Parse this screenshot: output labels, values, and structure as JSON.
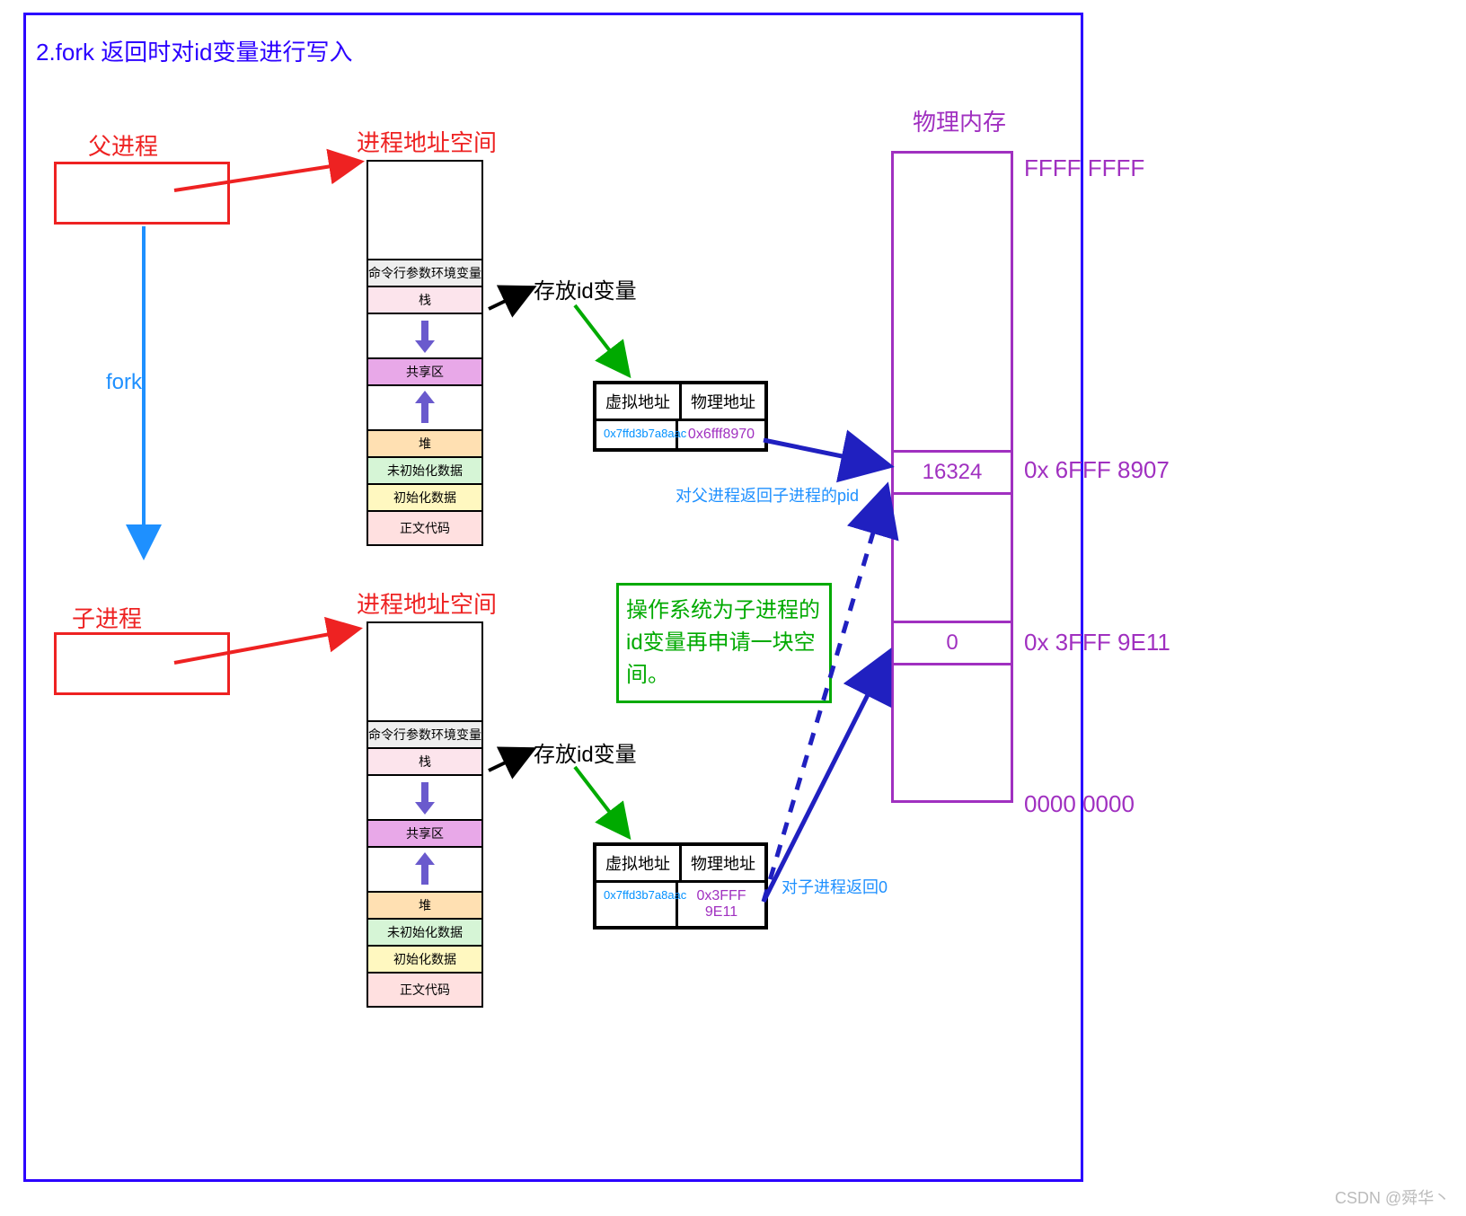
{
  "title": "2.fork 返回时对id变量进行写入",
  "process": {
    "parent_label": "父进程",
    "child_label": "子进程",
    "fork_label": "fork"
  },
  "addrspace": {
    "title": "进程地址空间",
    "segments": {
      "env": "命令行参数环境变量",
      "stack": "栈",
      "shared": "共享区",
      "heap": "堆",
      "bss": "未初始化数据",
      "data": "初始化数据",
      "text": "正文代码"
    },
    "id_var_label": "存放id变量"
  },
  "pagetable": {
    "col_virtual": "虚拟地址",
    "col_physical": "物理地址",
    "parent": {
      "vaddr": "0x7ffd3b7a8aac",
      "paddr": "0x6fff8970"
    },
    "child": {
      "vaddr": "0x7ffd3b7a8aac",
      "paddr": "0x3FFF 9E11"
    }
  },
  "phys": {
    "title": "物理内存",
    "top_addr": "FFFF FFFF",
    "bottom_addr": "0000 0000",
    "cell_parent": {
      "value": "16324",
      "addr": "0x 6FFF 8907"
    },
    "cell_child": {
      "value": "0",
      "addr": "0x 3FFF 9E11"
    }
  },
  "annotations": {
    "return_to_parent": "对父进程返回子进程的pid",
    "return_to_child": "对子进程返回0",
    "os_alloc": "操作系统为子进程的id变量再申请一块空间。"
  },
  "watermark": "CSDN @舜华丶"
}
